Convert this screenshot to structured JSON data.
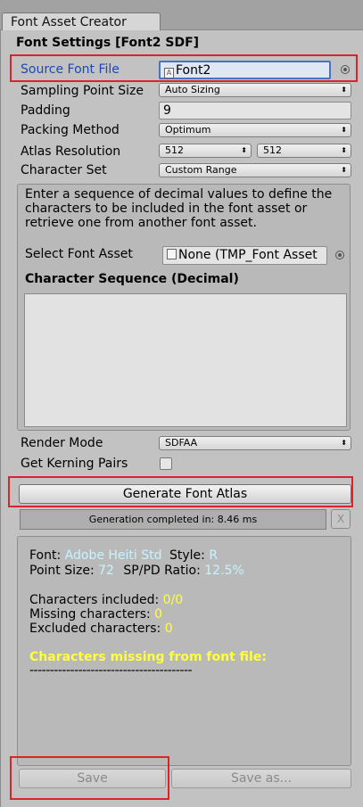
{
  "window": {
    "tab_title": "Font Asset Creator"
  },
  "settings": {
    "header": "Font Settings [Font2 SDF]",
    "source_font": {
      "label": "Source Font File",
      "value": "Font2"
    },
    "sampling": {
      "label": "Sampling Point Size",
      "value": "Auto Sizing"
    },
    "padding": {
      "label": "Padding",
      "value": "9"
    },
    "packing": {
      "label": "Packing Method",
      "value": "Optimum"
    },
    "atlas": {
      "label": "Atlas Resolution",
      "width": "512",
      "height": "512"
    },
    "charset": {
      "label": "Character Set",
      "value": "Custom Range"
    }
  },
  "custom_range": {
    "help": "Enter a sequence of decimal values to define the characters to be included in the font asset or retrieve one from another font asset.",
    "select_label": "Select Font Asset",
    "select_value": "None (TMP_Font Asset",
    "sequence_label": "Character Sequence (Decimal)"
  },
  "render": {
    "label": "Render Mode",
    "value": "SDFAA"
  },
  "kerning": {
    "label": "Get Kerning Pairs",
    "checked": false
  },
  "generate": {
    "label": "Generate Font Atlas"
  },
  "progress": {
    "text": "Generation completed in: 8.46 ms",
    "close": "X"
  },
  "info": {
    "font_label": "Font:",
    "font_value": "Adobe Heiti Std",
    "style_label": "Style:",
    "style_value": "R",
    "point_label": "Point Size:",
    "point_value": "72",
    "ratio_label": "SP/PD Ratio:",
    "ratio_value": "12.5%",
    "included_label": "Characters included:",
    "included_value": "0/0",
    "missing_label": "Missing characters:",
    "missing_value": "0",
    "excluded_label": "Excluded characters:",
    "excluded_value": "0",
    "missing_title": "Characters missing from font file:",
    "divider": "----------------------------------------"
  },
  "footer": {
    "save": "Save",
    "save_as": "Save as..."
  },
  "colors": {
    "highlight_red": "#d9242c",
    "label_blue": "#1a48b5",
    "value_cyan": "#c6f4ff",
    "value_yellow": "#ffff3c"
  }
}
